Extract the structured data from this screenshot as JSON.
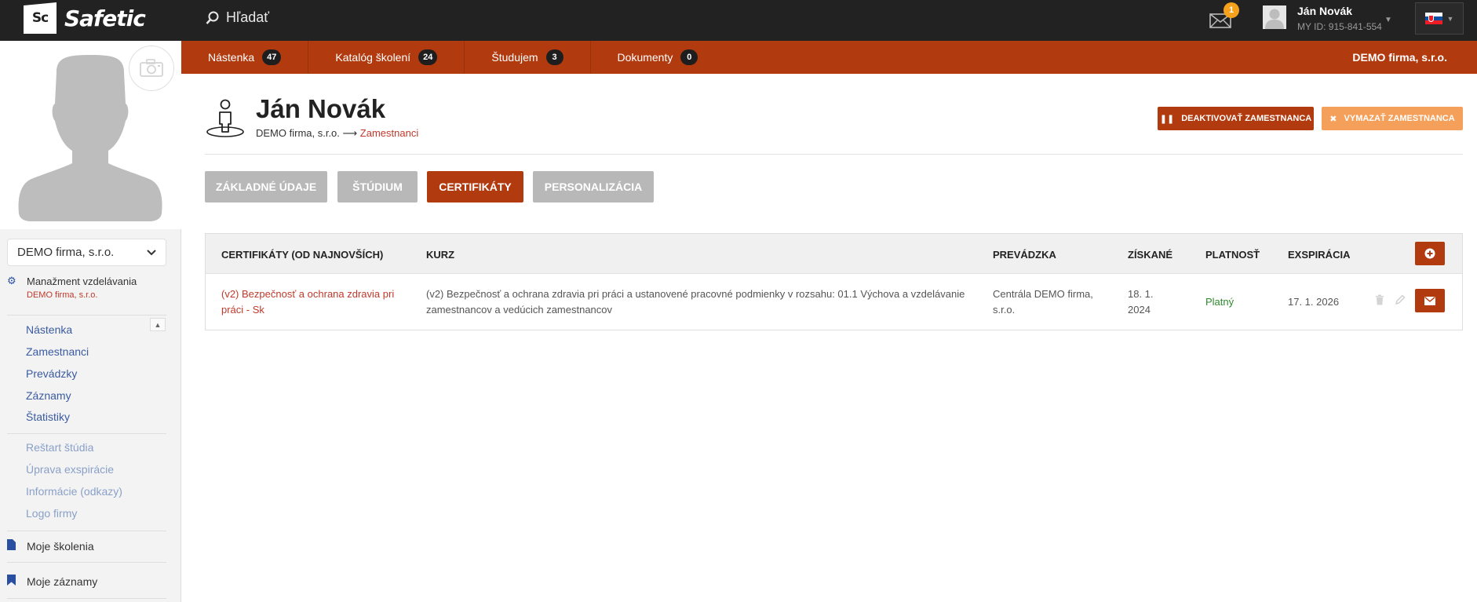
{
  "app": {
    "logo_mark": "Sc",
    "logo_text": "Safetic",
    "search_placeholder": "Hľadať"
  },
  "topbar": {
    "mail_count": "1",
    "user_name": "Ján Novák",
    "user_id": "MY ID: 915-841-554",
    "language": "sk"
  },
  "nav": {
    "items": [
      {
        "label": "Nástenka",
        "count": "47"
      },
      {
        "label": "Katalóg školení",
        "count": "24"
      },
      {
        "label": "Študujem",
        "count": "3"
      },
      {
        "label": "Dokumenty",
        "count": "0"
      }
    ],
    "company": "DEMO firma, s.r.o."
  },
  "sidebar": {
    "company_select": "DEMO firma, s.r.o.",
    "section_title": "Manažment vzdelávania",
    "section_sub": "DEMO firma, s.r.o.",
    "items": [
      "Nástenka",
      "Zamestnanci",
      "Prevádzky",
      "Záznamy",
      "Štatistiky"
    ],
    "muted_items": [
      "Reštart štúdia",
      "Úprava exspirácie",
      "Informácie (odkazy)",
      "Logo firmy"
    ],
    "links": [
      "Moje školenia",
      "Moje záznamy"
    ]
  },
  "header": {
    "title": "Ján Novák",
    "breadcrumb_company": "DEMO firma, s.r.o.",
    "breadcrumb_arrow": "⟶",
    "breadcrumb_link": "Zamestnanci",
    "deactivate_label": "DEAKTIVOVAŤ ZAMESTNANCA",
    "delete_label": "VYMAZAŤ ZAMESTNANCA"
  },
  "tabs": [
    "ZÁKLADNÉ ÚDAJE",
    "ŠTÚDIUM",
    "CERTIFIKÁTY",
    "PERSONALIZÁCIA"
  ],
  "table": {
    "headers": {
      "cert": "CERTIFIKÁTY (OD NAJNOVŠÍCH)",
      "course": "KURZ",
      "site": "PREVÁDZKA",
      "obtained": "ZÍSKANÉ",
      "validity": "PLATNOSŤ",
      "expiry": "EXSPIRÁCIA"
    },
    "rows": [
      {
        "cert": "(v2) Bezpečnosť a ochrana zdravia pri práci - Sk",
        "course": "(v2) Bezpečnosť a ochrana zdravia pri práci a ustanovené pracovné podmienky v rozsahu: 01.1 Výchova a vzdelávanie zamestnancov a vedúcich zamestnancov",
        "site": "Centrála DEMO firma, s.r.o.",
        "obtained": "18. 1. 2024",
        "validity": "Platný",
        "expiry": "17. 1. 2026"
      }
    ]
  },
  "colors": {
    "brand": "#b23a0f",
    "topbar": "#222222",
    "delete": "#f5a05a",
    "valid": "#2e8b2e",
    "badge": "#f5a11c"
  }
}
